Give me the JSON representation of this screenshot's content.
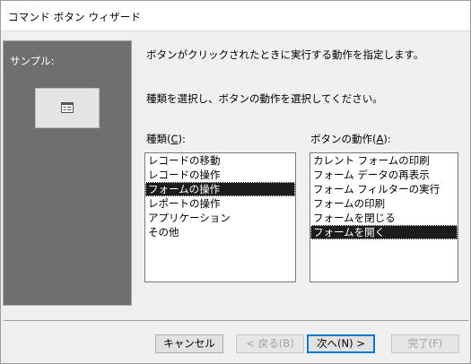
{
  "window": {
    "title": "コマンド ボタン ウィザード"
  },
  "sample": {
    "label": "サンプル:",
    "preview_icon": "form-window-icon"
  },
  "instructions": {
    "line1": "ボタンがクリックされたときに実行する動作を指定します。",
    "line2": "種類を選択し、ボタンの動作を選択してください。"
  },
  "categories": {
    "label_prefix": "種類(",
    "label_key": "C",
    "label_suffix": "):",
    "items": [
      "レコードの移動",
      "レコードの操作",
      "フォームの操作",
      "レポートの操作",
      "アプリケーション",
      "その他"
    ],
    "selected_index": 2
  },
  "actions": {
    "label_prefix": "ボタンの動作(",
    "label_key": "A",
    "label_suffix": "):",
    "items": [
      "カレント フォームの印刷",
      "フォーム データの再表示",
      "フォーム フィルターの実行",
      "フォームの印刷",
      "フォームを閉じる",
      "フォームを開く"
    ],
    "selected_index": 5
  },
  "buttons": {
    "cancel": "キャンセル",
    "back": "< 戻る(B)",
    "next": "次へ(N) >",
    "finish": "完了(F)"
  }
}
